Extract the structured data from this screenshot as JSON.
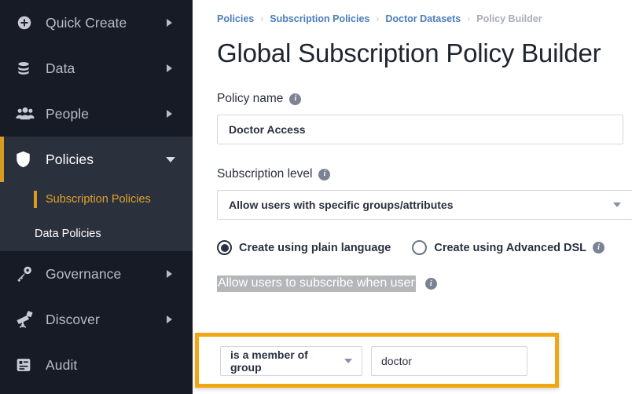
{
  "sidebar": {
    "items": [
      {
        "label": "Quick Create",
        "icon": "plus-circle-icon",
        "expandable": true
      },
      {
        "label": "Data",
        "icon": "database-icon",
        "expandable": true
      },
      {
        "label": "People",
        "icon": "people-group-icon",
        "expandable": true
      },
      {
        "label": "Policies",
        "icon": "shield-icon",
        "expandable": true,
        "expanded": true
      },
      {
        "label": "Governance",
        "icon": "key-icon",
        "expandable": true
      },
      {
        "label": "Discover",
        "icon": "telescope-icon",
        "expandable": true
      },
      {
        "label": "Audit",
        "icon": "report-icon",
        "expandable": false
      }
    ],
    "policies_subitems": [
      {
        "label": "Subscription Policies",
        "active": true
      },
      {
        "label": "Data Policies",
        "active": false
      }
    ],
    "colors": {
      "background": "#171b25",
      "expanded_background": "#2b303d",
      "accent": "#d89b22",
      "active_text": "#e0a22c"
    }
  },
  "breadcrumb": {
    "items": [
      {
        "label": "Policies",
        "current": false
      },
      {
        "label": "Subscription Policies",
        "current": false
      },
      {
        "label": "Doctor Datasets",
        "current": false
      },
      {
        "label": "Policy Builder",
        "current": true
      }
    ],
    "separator": "›"
  },
  "page": {
    "title": "Global Subscription Policy Builder"
  },
  "policy_name": {
    "label": "Policy name",
    "info": "i",
    "value": "Doctor Access",
    "placeholder": "Policy name"
  },
  "subscription_level": {
    "label": "Subscription level",
    "info": "i",
    "selected": "Allow users with specific groups/attributes",
    "options": [
      "Allow users with specific groups/attributes"
    ]
  },
  "creation_mode": {
    "options": [
      {
        "label": "Create using plain language",
        "selected": true,
        "has_info": false
      },
      {
        "label": "Create using Advanced DSL",
        "selected": false,
        "has_info": true
      }
    ],
    "info": "i"
  },
  "rule_builder": {
    "sentence_text": "Allow users to subscribe when user",
    "sentence_selected": true,
    "info": "i",
    "condition": {
      "operator_selected": "is a member of group",
      "operator_options": [
        "is a member of group"
      ],
      "value": "doctor",
      "placeholder": ""
    },
    "highlight_color": "#f0a711"
  }
}
